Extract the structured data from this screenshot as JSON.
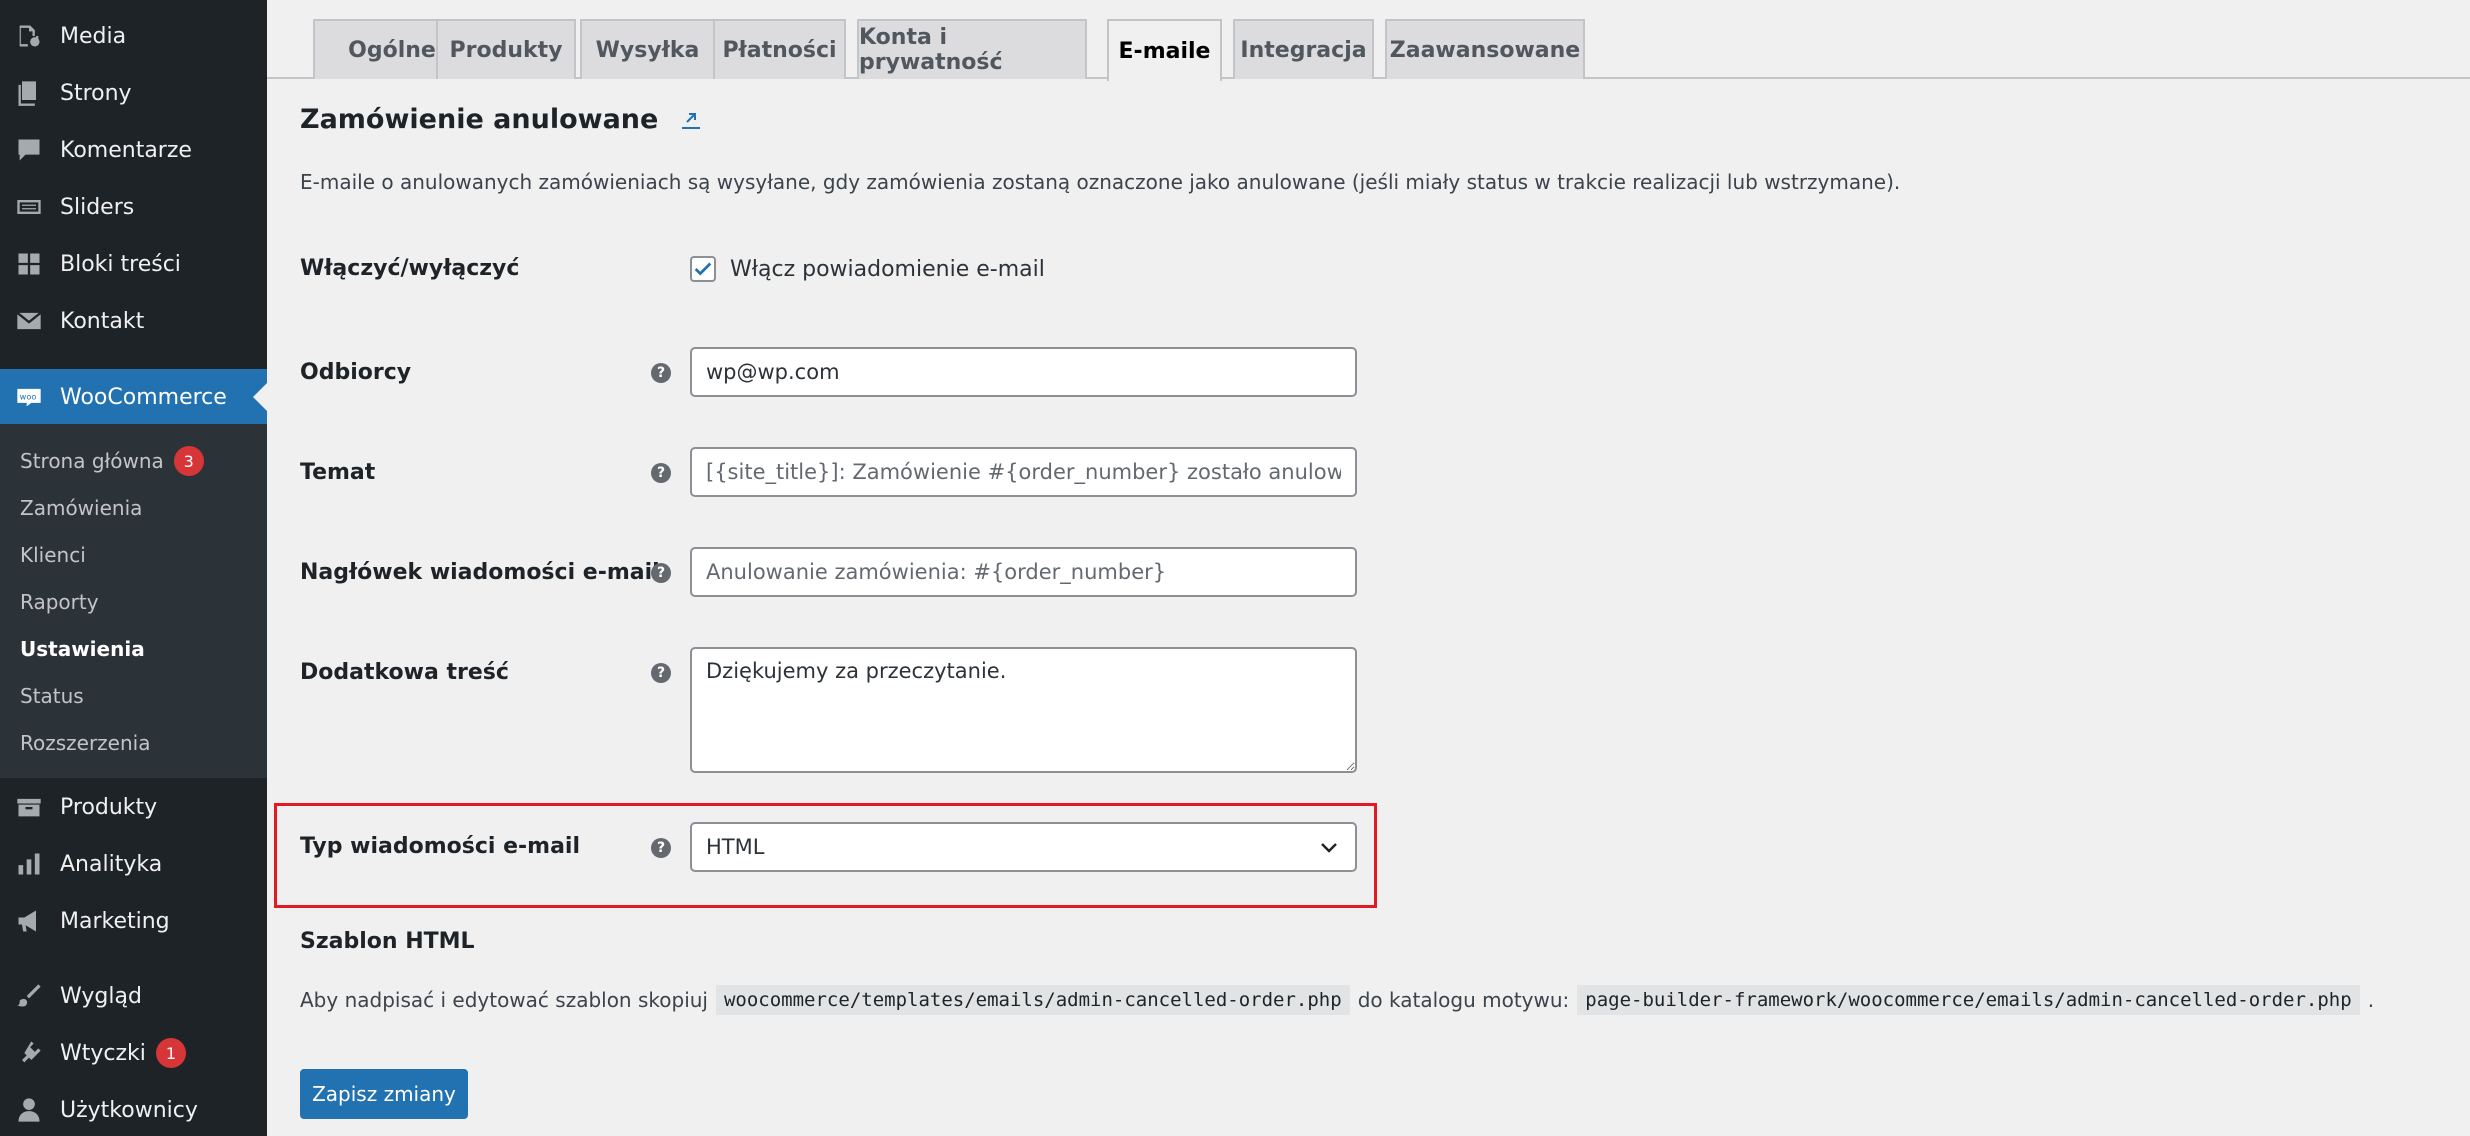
{
  "sidebar": {
    "items_top": [
      {
        "label": "Media",
        "icon": "media-icon"
      },
      {
        "label": "Strony",
        "icon": "pages-icon"
      },
      {
        "label": "Komentarze",
        "icon": "comments-icon"
      },
      {
        "label": "Sliders",
        "icon": "sliders-icon"
      },
      {
        "label": "Bloki treści",
        "icon": "blocks-icon"
      },
      {
        "label": "Kontakt",
        "icon": "mail-icon"
      }
    ],
    "woocommerce": {
      "label": "WooCommerce",
      "icon": "woo-icon"
    },
    "submenu": [
      {
        "label": "Strona główna",
        "badge": "3"
      },
      {
        "label": "Zamówienia"
      },
      {
        "label": "Klienci"
      },
      {
        "label": "Raporty"
      },
      {
        "label": "Ustawienia"
      },
      {
        "label": "Status"
      },
      {
        "label": "Rozszerzenia"
      }
    ],
    "items_bottom": [
      {
        "label": "Produkty",
        "icon": "products-icon"
      },
      {
        "label": "Analityka",
        "icon": "analytics-icon"
      },
      {
        "label": "Marketing",
        "icon": "megaphone-icon"
      },
      {
        "label": "Wygląd",
        "icon": "brush-icon"
      },
      {
        "label": "Wtyczki",
        "icon": "plugins-icon",
        "badge": "1"
      },
      {
        "label": "Użytkownicy",
        "icon": "user-icon"
      }
    ]
  },
  "tabs": [
    {
      "label": "Ogólne"
    },
    {
      "label": "Produkty"
    },
    {
      "label": "Wysyłka"
    },
    {
      "label": "Płatności"
    },
    {
      "label": "Konta i prywatność"
    },
    {
      "label": "E-maile",
      "active": true
    },
    {
      "label": "Integracja"
    },
    {
      "label": "Zaawansowane"
    }
  ],
  "section": {
    "title": "Zamówienie anulowane",
    "description": "E-maile o anulowanych zamówieniach są wysyłane, gdy zamówienia zostaną oznaczone jako anulowane (jeśli miały status w trakcie realizacji lub wstrzymane)."
  },
  "form": {
    "enable": {
      "label": "Włączyć/wyłączyć",
      "checkbox_label": "Włącz powiadomienie e-mail",
      "checked": true
    },
    "recipient": {
      "label": "Odbiorcy",
      "value": "wp@wp.com"
    },
    "subject": {
      "label": "Temat",
      "placeholder": "[{site_title}]: Zamówienie #{order_number} zostało anulowane"
    },
    "heading": {
      "label": "Nagłówek wiadomości e-mail",
      "placeholder": "Anulowanie zamówienia: #{order_number}"
    },
    "additional": {
      "label": "Dodatkowa treść",
      "value": "Dziękujemy za przeczytanie."
    },
    "email_type": {
      "label": "Typ wiadomości e-mail",
      "value": "HTML"
    }
  },
  "template": {
    "heading": "Szablon HTML",
    "text_before": "Aby nadpisać i edytować szablon skopiuj",
    "code1": "woocommerce/templates/emails/admin-cancelled-order.php",
    "text_middle": "do katalogu motywu:",
    "code2": "page-builder-framework/woocommerce/emails/admin-cancelled-order.php",
    "text_after": "."
  },
  "save_label": "Zapisz zmiany",
  "colors": {
    "accent": "#2271b1",
    "sidebar": "#1d2327",
    "highlight": "#e01b24",
    "badge": "#d63638"
  }
}
